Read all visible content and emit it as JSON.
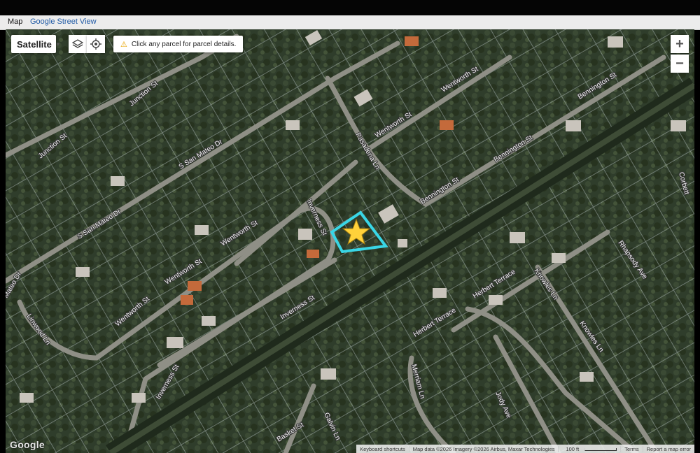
{
  "tabs": [
    {
      "label": "Map"
    },
    {
      "label": "Google Street View"
    }
  ],
  "map_type": {
    "label": "Satellite"
  },
  "hint": {
    "text": "Click any parcel for parcel details."
  },
  "zoom": {
    "in_label": "+",
    "out_label": "−"
  },
  "attribution": {
    "google": "Google",
    "shortcuts": "Keyboard shortcuts",
    "data": "Map data ©2026 Imagery ©2026 Airbus, Maxar Technologies",
    "scale": "100 ft",
    "terms": "Terms",
    "report": "Report a map error"
  },
  "streets": [
    "S San Mateo Dr",
    "S San Mateo Dr",
    "Junction St",
    "Junction St",
    "Wentworth St",
    "Wentworth St",
    "Wentworth St",
    "Wentworth St",
    "Wentworth St",
    "Pasadena Ln",
    "Inverness St",
    "Inverness St",
    "Inverness St",
    "Bennington St",
    "Bennington St",
    "Bennington St",
    "Herbert Terrace",
    "Herbert Terrace",
    "Knowles Ln",
    "Knowles Ln",
    "Rhapsody Ave",
    "Jody Ave",
    "Merriam Ln",
    "Basket St",
    "Galvin Ln",
    "Linwood Ln",
    "Mateo Dr",
    "Corbett"
  ],
  "icons": {
    "layers": "layers-icon",
    "locate": "locate-icon",
    "warning": "warning-icon",
    "star": "star-marker-icon",
    "pegman": "pegman-icon"
  },
  "colors": {
    "highlight": "#39d6e6",
    "star": "#ffd23a",
    "link": "#1f5aa6"
  }
}
